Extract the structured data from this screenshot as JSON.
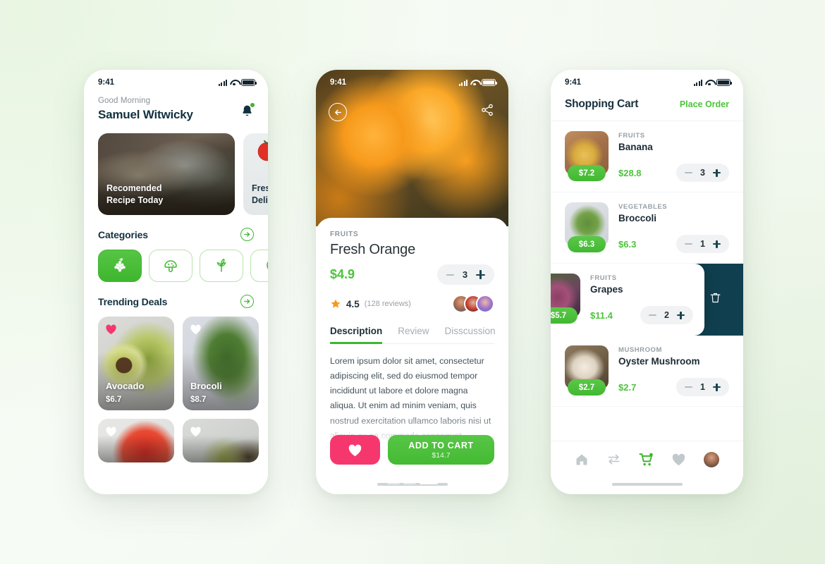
{
  "status_bar": {
    "time": "9:41",
    "icons": [
      "signal-icon",
      "wifi-icon",
      "battery-icon"
    ]
  },
  "home": {
    "greeting": "Good Morning",
    "user_name": "Samuel Witwicky",
    "notification_icon": "bell-icon",
    "banners": [
      {
        "caption_line1": "Recomended",
        "caption_line2": "Recipe Today"
      },
      {
        "caption_line1": "Fresh",
        "caption_line2": "Delivery"
      }
    ],
    "categories_section": {
      "title": "Categories",
      "arrow": "arrow-right-icon"
    },
    "categories": [
      {
        "icon": "grapes-icon",
        "active": true
      },
      {
        "icon": "mushroom-icon",
        "active": false
      },
      {
        "icon": "leaf-icon",
        "active": false
      },
      {
        "icon": "vegetable-icon",
        "active": false
      }
    ],
    "deals_section": {
      "title": "Trending Deals",
      "arrow": "arrow-right-icon"
    },
    "deals": [
      {
        "name": "Avocado",
        "price": "$6.7",
        "favorite": true
      },
      {
        "name": "Brocoli",
        "price": "$8.7",
        "favorite": false
      },
      {
        "name": "",
        "price": "",
        "favorite": false
      },
      {
        "name": "",
        "price": "",
        "favorite": false
      }
    ]
  },
  "detail": {
    "back_icon": "back-arrow-icon",
    "share_icon": "share-icon",
    "carousel_dots": 3,
    "carousel_active_index": 2,
    "category": "FRUITS",
    "title": "Fresh Orange",
    "price": "$4.9",
    "quantity": "3",
    "rating": "4.5",
    "reviews": "(128 reviews)",
    "star_icon": "star-icon",
    "tabs": [
      {
        "label": "Description",
        "active": true
      },
      {
        "label": "Review",
        "active": false
      },
      {
        "label": "Disscussion",
        "active": false
      }
    ],
    "description": "Lorem ipsum dolor sit amet, consectetur adipiscing elit, sed do eiusmod tempor incididunt ut labore et dolore magna aliqua. Ut enim ad minim veniam, quis nostrud exercitation ullamco laboris nisi ut aliquip ex ea commodo consequat.",
    "favorite_icon": "heart-icon",
    "add_to_cart_label": "ADD TO CART",
    "add_to_cart_total": "$14.7"
  },
  "cart": {
    "title": "Shopping Cart",
    "place_order_label": "Place Order",
    "items": [
      {
        "category": "FRUITS",
        "name": "Banana",
        "unit_price": "$7.2",
        "total": "$28.8",
        "quantity": "3",
        "swiped": false
      },
      {
        "category": "VEGETABLES",
        "name": "Broccoli",
        "unit_price": "$6.3",
        "total": "$6.3",
        "quantity": "1",
        "swiped": false
      },
      {
        "category": "FRUITS",
        "name": "Grapes",
        "unit_price": "$5.7",
        "total": "$11.4",
        "quantity": "2",
        "swiped": true
      },
      {
        "category": "MUSHROOM",
        "name": "Oyster Mushroom",
        "unit_price": "$2.7",
        "total": "$2.7",
        "quantity": "1",
        "swiped": false
      }
    ],
    "delete_icon": "trash-icon",
    "nav": [
      {
        "icon": "home-icon",
        "active": false
      },
      {
        "icon": "transfer-icon",
        "active": false
      },
      {
        "icon": "cart-icon",
        "active": true
      },
      {
        "icon": "heart-icon",
        "active": false
      },
      {
        "icon": "profile-avatar-icon",
        "active": false
      }
    ]
  },
  "colors": {
    "green": "#3fb62f",
    "green_light": "#4cc43a",
    "pink": "#f6376e",
    "dark": "#12313f",
    "teal_dark": "#104050",
    "orange": "#f79a1c"
  }
}
